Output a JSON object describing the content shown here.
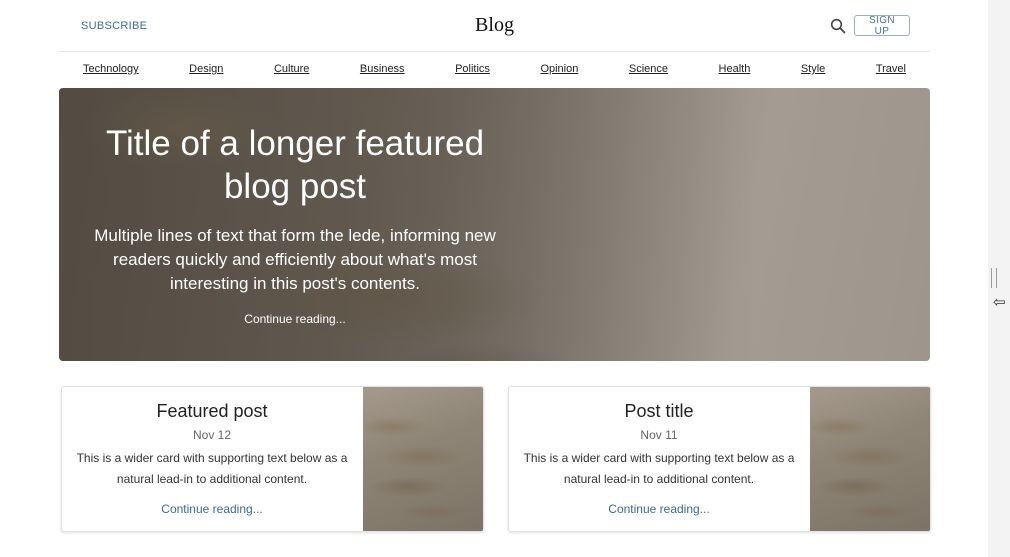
{
  "header": {
    "subscribe_label": "SUBSCRIBE",
    "title": "Blog",
    "search_icon": "search-icon",
    "signup_label": "SIGN UP"
  },
  "nav": {
    "items": [
      "Technology",
      "Design",
      "Culture",
      "Business",
      "Politics",
      "Opinion",
      "Science",
      "Health",
      "Style",
      "Travel"
    ]
  },
  "hero": {
    "title": "Title of a longer featured blog post",
    "lede": "Multiple lines of text that form the lede, informing new readers quickly and efficiently about what's most interesting in this post's contents.",
    "link": "Continue reading..."
  },
  "cards": [
    {
      "title": "Featured post",
      "date": "Nov 12",
      "text": "This is a wider card with supporting text below as a natural lead-in to additional content.",
      "link": "Continue reading..."
    },
    {
      "title": "Post title",
      "date": "Nov 11",
      "text": "This is a wider card with supporting text below as a natural lead-in to additional content.",
      "link": "Continue reading..."
    }
  ],
  "colors": {
    "link_blue": "#3d6a9c",
    "text_dark": "#222222"
  },
  "icons": {
    "resize_cursor": "⇦"
  }
}
